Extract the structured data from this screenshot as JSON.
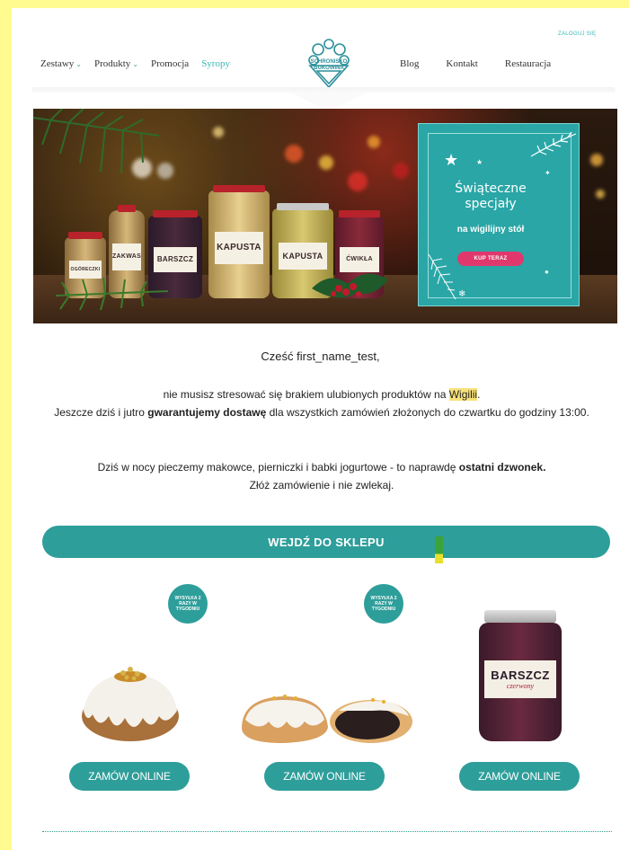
{
  "header": {
    "nav_left": [
      {
        "label": "Zestawy",
        "has_dropdown": true
      },
      {
        "label": "Produkty",
        "has_dropdown": true
      },
      {
        "label": "Promocja",
        "has_dropdown": false
      },
      {
        "label": "Syropy",
        "has_dropdown": false,
        "active": true
      }
    ],
    "nav_right": [
      {
        "label": "Blog"
      },
      {
        "label": "Kontakt"
      },
      {
        "label": "Restauracja"
      }
    ],
    "login_label": "ZALOGUJ SIĘ",
    "logo_line1": "SCHRONISKO",
    "logo_line2": "BUKOWINA"
  },
  "banner": {
    "jars": [
      {
        "label": "OGÓRECZKI"
      },
      {
        "label": "ZAKWAS"
      },
      {
        "label": "BARSZCZ"
      },
      {
        "label": "KAPUSTA"
      },
      {
        "label": "KAPUSTA"
      },
      {
        "label": "ĆWIKŁA"
      }
    ],
    "promo_title_line1": "Świąteczne",
    "promo_title_line2": "specjały",
    "promo_subtitle": "na wigilijny stół",
    "promo_button": "KUP TERAZ"
  },
  "body": {
    "greeting": "Cześć first_name_test,",
    "p1_a": "nie musisz stresować się brakiem ulubionych produktów na ",
    "p1_highlight": "Wigilii",
    "p1_b": ".",
    "p1_c": "Jeszcze dziś i jutro ",
    "p1_bold": "gwarantujemy dostawę",
    "p1_d": " dla wszystkich zamówień złożonych do czwartku do godziny 13:00.",
    "p2_a": "Dziś w nocy pieczemy makowce, pierniczki i babki jogurtowe - to naprawdę ",
    "p2_bold": "ostatni dzwonek.",
    "p2_b": "Złóż zamówienie i nie zwlekaj."
  },
  "shop_button": "WEJDŹ DO SKLEPU",
  "products": [
    {
      "badge": "WYSYŁKA 2 RAZY W TYGODNIU",
      "button": "ZAMÓW ONLINE",
      "jar_label": ""
    },
    {
      "badge": "WYSYŁKA 2 RAZY W TYGODNIU",
      "button": "ZAMÓW ONLINE",
      "jar_label": ""
    },
    {
      "badge": "",
      "button": "ZAMÓW ONLINE",
      "jar_label": "BARSZCZ",
      "jar_sublabel": "czerwony"
    }
  ],
  "colors": {
    "teal": "#2e9e9a",
    "teal_light": "#3bb7b5",
    "pink": "#e0386d",
    "page_bg": "#fffb8f"
  }
}
